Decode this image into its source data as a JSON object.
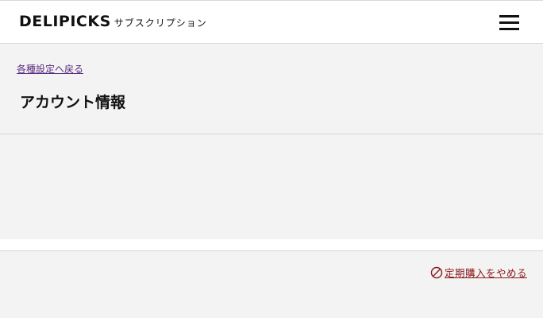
{
  "header": {
    "logo_main": "DELIPICKS",
    "logo_sub": "サブスクリプション",
    "menu_icon": "hamburger-menu-icon"
  },
  "account": {
    "back_link": "各種設定へ戻る",
    "title": "アカウント情報"
  },
  "footer_actions": {
    "cancel_label": "定期購入をやめる",
    "cancel_icon": "prohibited-icon",
    "cancel_color": "#8b1a1a"
  },
  "colors": {
    "background": "#f3f3f3",
    "link": "#5a2d82"
  }
}
